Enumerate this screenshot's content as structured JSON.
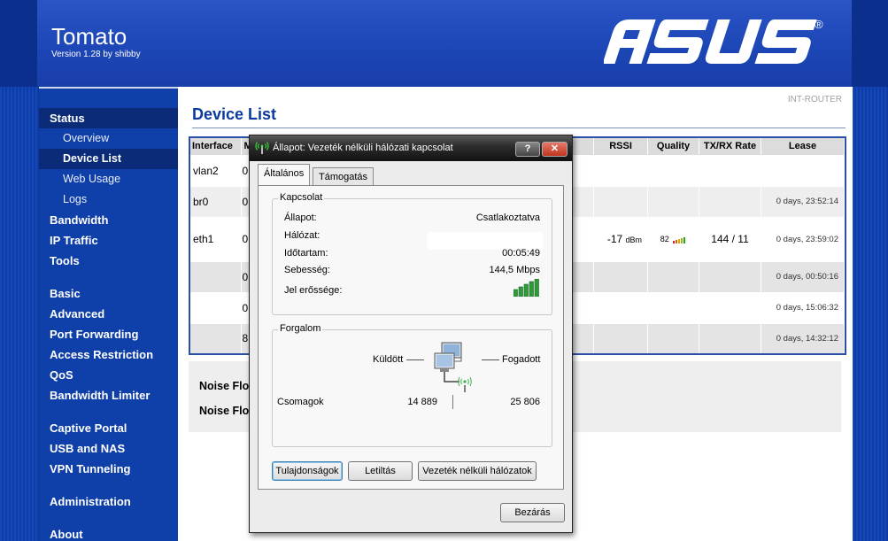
{
  "app": {
    "title": "Tomato",
    "version": "Version 1.28 by shibby",
    "brand": "ASUS",
    "brand_mark": "®",
    "router_name": "INT-ROUTER"
  },
  "sidebar": {
    "status_label": "Status",
    "status_sub": [
      "Overview",
      "Device List",
      "Web Usage",
      "Logs"
    ],
    "group1": [
      "Bandwidth",
      "IP Traffic",
      "Tools"
    ],
    "group2": [
      "Basic",
      "Advanced",
      "Port Forwarding",
      "Access Restriction",
      "QoS",
      "Bandwidth Limiter"
    ],
    "group3": [
      "Captive Portal",
      "USB and NAS",
      "VPN Tunneling"
    ],
    "group4": [
      "Administration"
    ],
    "group5": [
      "About"
    ]
  },
  "main": {
    "page_title": "Device List",
    "columns": {
      "interface": "Interface",
      "mac_initial": "M",
      "rssi": "RSSI",
      "quality": "Quality",
      "rate": "TX/RX Rate",
      "lease": "Lease"
    },
    "rows": [
      {
        "interface": "vlan2",
        "mac_initial": "0",
        "rssi": "",
        "rssi_unit": "",
        "quality": "",
        "rate": "",
        "lease": ""
      },
      {
        "interface": "br0",
        "mac_initial": "0",
        "rssi": "",
        "rssi_unit": "",
        "quality": "",
        "rate": "",
        "lease": "0 days, 23:52:14"
      },
      {
        "interface": "eth1",
        "mac_initial": "0",
        "rssi": "-17",
        "rssi_unit": "dBm",
        "quality": "82",
        "rate": "144 / 11",
        "lease": "0 days, 23:59:02"
      },
      {
        "interface": "",
        "mac_initial": "0",
        "rssi": "",
        "rssi_unit": "",
        "quality": "",
        "rate": "",
        "lease": "0 days, 00:50:16"
      },
      {
        "interface": "",
        "mac_initial": "0",
        "rssi": "",
        "rssi_unit": "",
        "quality": "",
        "rate": "",
        "lease": "0 days, 15:06:32"
      },
      {
        "interface": "",
        "mac_initial": "8",
        "rssi": "",
        "rssi_unit": "",
        "quality": "",
        "rate": "",
        "lease": "0 days, 14:32:12"
      }
    ],
    "noise_label_1": "Noise Flo",
    "noise_label_2": "Noise Flo"
  },
  "dialog": {
    "title": "Állapot: Vezeték nélküli hálózati kapcsolat",
    "help_label": "?",
    "close_glyph": "✕",
    "tabs": [
      "Általános",
      "Támogatás"
    ],
    "connection": {
      "group_label": "Kapcsolat",
      "status_label": "Állapot:",
      "status_value": "Csatlakoztatva",
      "network_label": "Hálózat:",
      "duration_label": "Időtartam:",
      "duration_value": "00:05:49",
      "speed_label": "Sebesség:",
      "speed_value": "144,5 Mbps",
      "signal_label": "Jel erőssége:",
      "signal_bars": 5
    },
    "traffic": {
      "group_label": "Forgalom",
      "sent_label": "Küldött",
      "received_label": "Fogadott",
      "packets_label": "Csomagok",
      "packets_sent": "14 889",
      "packets_received": "25 806"
    },
    "buttons": {
      "properties": "Tulajdonságok",
      "disable": "Letiltás",
      "wireless_networks": "Vezeték nélküli hálózatok",
      "close": "Bezárás"
    }
  },
  "colors": {
    "sidebar_bg": "#0f3fa8",
    "accent_title": "#0b3a9f",
    "signal_green": "#2e9a3a"
  }
}
